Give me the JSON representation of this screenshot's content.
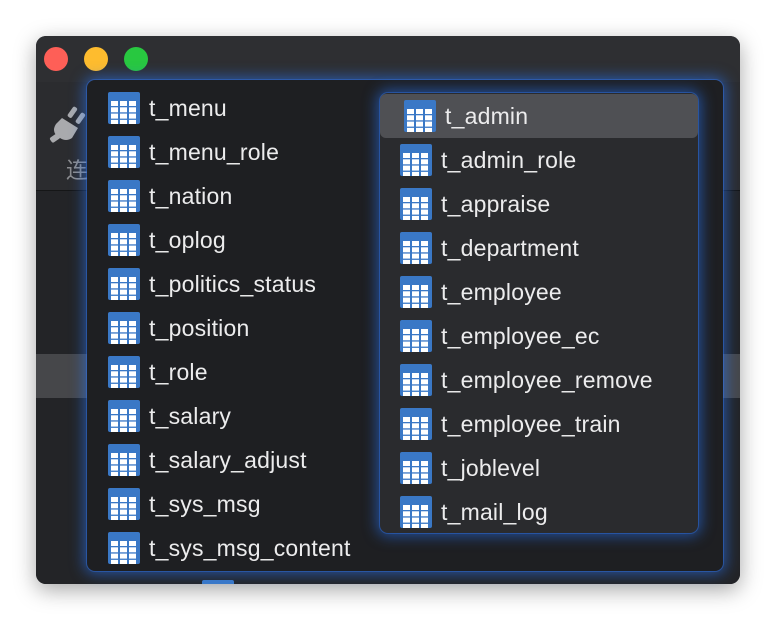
{
  "window": {
    "toolbar_label": "连"
  },
  "popup": {
    "left_items": [
      {
        "label": "t_menu"
      },
      {
        "label": "t_menu_role"
      },
      {
        "label": "t_nation"
      },
      {
        "label": "t_oplog"
      },
      {
        "label": "t_politics_status"
      },
      {
        "label": "t_position"
      },
      {
        "label": "t_role"
      },
      {
        "label": "t_salary"
      },
      {
        "label": "t_salary_adjust"
      },
      {
        "label": "t_sys_msg"
      },
      {
        "label": "t_sys_msg_content"
      }
    ],
    "right_items": [
      {
        "label": "t_admin",
        "selected": true
      },
      {
        "label": "t_admin_role"
      },
      {
        "label": "t_appraise"
      },
      {
        "label": "t_department"
      },
      {
        "label": "t_employee"
      },
      {
        "label": "t_employee_ec"
      },
      {
        "label": "t_employee_remove"
      },
      {
        "label": "t_employee_train"
      },
      {
        "label": "t_joblevel"
      },
      {
        "label": "t_mail_log"
      }
    ]
  },
  "icons": {
    "table_item": "table-icon",
    "toolbar": "plug-icon"
  },
  "colors": {
    "accent_glow": "#2878ff",
    "table_icon": "#3a78c6",
    "selected_row": "#4f5054"
  }
}
